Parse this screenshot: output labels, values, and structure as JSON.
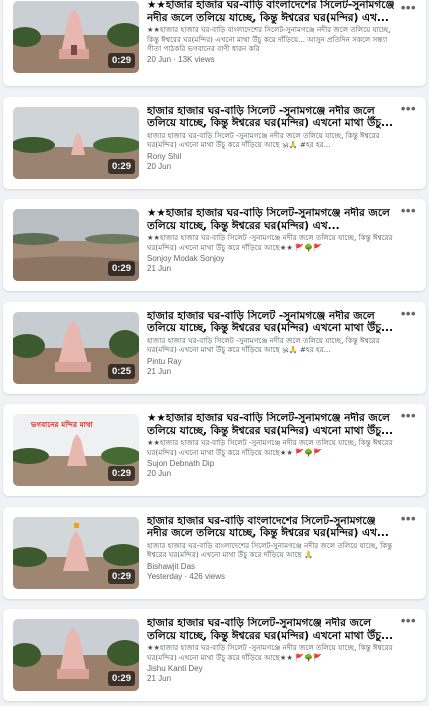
{
  "videos": [
    {
      "duration": "0:29",
      "title": "★★হাজার হাজার ঘর-বাড়ি বাংলাদেশের সিলেট-সুনামগঞ্জে নদীর জলে তলিয়ে যাচ্ছে, কিন্তু ঈশ্বরের ঘর(মন্দির) এখ...",
      "desc": "★★হাজার হাজার ঘর-বাড়ি বাংলাদেশের সিলেট-সুনামগঞ্জে নদীর জলে তলিয়ে যাচ্ছে, কিন্তু ঈশ্বরের ঘর(মন্দির) এখনো মাথা উঁচু করে দাঁড়িয়ে... আসুন প্রতিদিন সকলে সন্ধ্যা গীতা পাঠকরি ভগবানের বাণী ধারন করি",
      "author": "",
      "meta": "20 Jun · 13K views",
      "banner": ""
    },
    {
      "duration": "0:29",
      "title": "হাজার হাজার ঘর-বাড়ি সিলেট -সুনামগঞ্জে নদীর জলে তলিয়ে যাচ্ছে, কিন্তু ঈশ্বরের ঘর(মন্দির) এখনো মাথা উঁচু...",
      "desc": "হাজার হাজার ঘর-বাড়ি সিলেট -সুনামগঞ্জে নদীর জলে তলিয়ে যাচ্ছে, কিন্তু ঈশ্বরের ঘর(মন্দির) এখনো মাথা উঁচু করে দাঁড়িয়ে আছে 🕉🙏 #হর হর...",
      "author": "Rony Shil",
      "meta": "20 Jun",
      "banner": ""
    },
    {
      "duration": "0:29",
      "title": "★★হাজার হাজার ঘর-বাড়ি সিলেট-সুনামগঞ্জে নদীর জলে তলিয়ে যাচ্ছে, কিন্তু ঈশ্বরের ঘর(মন্দির) এখ...",
      "desc": "★★হাজার হাজার ঘর-বাড়ি সিলেট -সুনামগঞ্জে নদীর জলে তলিয়ে যাচ্ছে, কিন্তু ঈশ্বরের ঘর(মন্দির) এখনো মাথা উঁচু করে দাঁড়িয়ে আছে★★ 🚩🌳🚩",
      "author": "Sonjoy Modak Sonjoy",
      "meta": "21 Jun",
      "banner": ""
    },
    {
      "duration": "0:25",
      "title": "হাজার হাজার ঘর-বাড়ি সিলেট -সুনামগঞ্জে নদীর জলে তলিয়ে যাচ্ছে, কিন্তু ঈশ্বরের ঘর(মন্দির) এখনো মাথা উঁচু...",
      "desc": "হাজার হাজার ঘর-বাড়ি সিলেট -সুনামগঞ্জে নদীর জলে তলিয়ে যাচ্ছে, কিন্তু ঈশ্বরের ঘর(মন্দির) এখনো মাথা উঁচু করে দাঁড়িয়ে আছে 🕉🙏 #হর হর...",
      "author": "Pintu Ray",
      "meta": "21 Jun",
      "banner": ""
    },
    {
      "duration": "0:29",
      "title": "★★হাজার হাজার ঘর-বাড়ি সিলেট-সুনামগঞ্জে নদীর জলে তলিয়ে যাচ্ছে, কিন্তু ঈশ্বরের ঘর(মন্দির) এখনো মাথা উঁচু...",
      "desc": "★★হাজার হাজার ঘর-বাড়ি সিলেট -সুনামগঞ্জে নদীর জলে তলিয়ে যাচ্ছে, কিন্তু ঈশ্বরের ঘর(মন্দির) এখনো মাথা উঁচু করে দাঁড়িয়ে আছে★★ 🚩🌳🚩",
      "author": "Sujon Debnath Dip",
      "meta": "20 Jun",
      "banner": "ভগবানের মন্দির মাথা"
    },
    {
      "duration": "0:29",
      "title": "হাজার হাজার ঘর-বাড়ি বাংলাদেশের সিলেট-সুনামগঞ্জে নদীর জলে তলিয়ে যাচ্ছে, কিন্তু ঈশ্বরের ঘর(মন্দির) এখ...",
      "desc": "হাজার হাজার ঘর-বাড়ি বাংলাদেশের সিলেট-সুনামগঞ্জে নদীর জলে তলিয়ে যাচ্ছে, কিন্তু ঈশ্বরের ঘর(মন্দির) এখনো মাথা উঁচু করে দাঁড়িয়ে আছে 🙏",
      "author": "Bishawjit Das",
      "meta": "Yesterday · 426 views",
      "banner": ""
    },
    {
      "duration": "0:29",
      "title": "হাজার হাজার ঘর-বাড়ি সিলেট-সুনামগঞ্জে নদীর জলে তলিয়ে যাচ্ছে, কিন্তু ঈশ্বরের ঘর(মন্দির) এখনো মাথা উঁচু...",
      "desc": "★★হাজার হাজার ঘর-বাড়ি সিলেট -সুনামগঞ্জে নদীর জলে তলিয়ে যাচ্ছে, কিন্তু ঈশ্বরের ঘর(মন্দির) এখনো মাথা উঁচু করে দাঁড়িয়ে আছে★★ 🚩🌳🚩",
      "author": "Jishu Kanti Dey",
      "meta": "21 Jun",
      "banner": ""
    }
  ],
  "more_icon": "ellipsis-icon",
  "colors": {
    "water": "#9a7f6a",
    "sky": "#c9cfd4",
    "temple": "#e8b8b0",
    "trees": "#3d5a2f"
  }
}
